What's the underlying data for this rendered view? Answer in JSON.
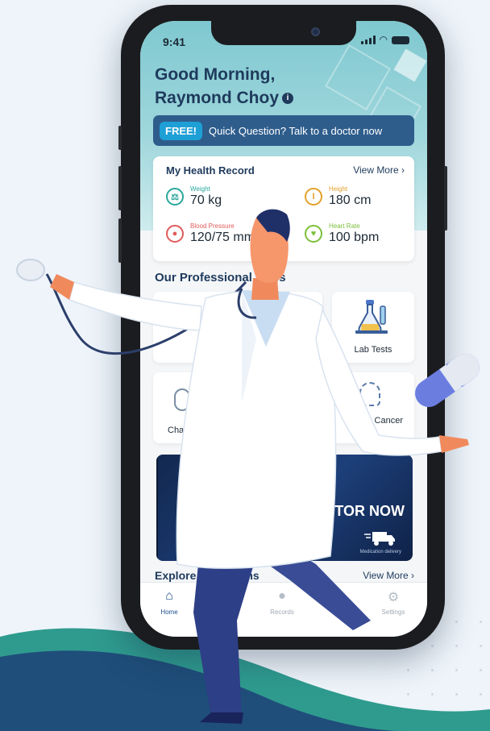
{
  "status": {
    "time": "9:41"
  },
  "greeting": {
    "line1": "Good Morning,",
    "line2": "Raymond Choy"
  },
  "promo": {
    "badge": "FREE!",
    "text": "Quick Question? Talk to a doctor now"
  },
  "health_record": {
    "title": "My Health Record",
    "view_more": "View More",
    "metrics": [
      {
        "label": "Weight",
        "value": "70 kg",
        "color": "#2aa79b",
        "icon": "scale-icon"
      },
      {
        "label": "Height",
        "value": "180 cm",
        "color": "#e2a12a",
        "icon": "ruler-icon"
      },
      {
        "label": "Blood Pressure",
        "value": "120/75 mm",
        "color": "#e05a5a",
        "icon": "blood-drop-icon"
      },
      {
        "label": "Heart Rate",
        "value": "100 bpm",
        "color": "#7bbf3a",
        "icon": "heart-icon"
      }
    ]
  },
  "services": {
    "title": "Our Professional  vices",
    "items": [
      {
        "label": "",
        "icon": "service-icon"
      },
      {
        "label": "Lab Tests",
        "icon": "flask-icon"
      },
      {
        "label": "Cha",
        "icon": "chat-icon"
      },
      {
        "label": "Cancer",
        "icon": "head-icon"
      }
    ]
  },
  "banner": {
    "text": "TOR NOW",
    "small": "Medication delivery",
    "icon": "delivery-truck-icon"
  },
  "explore": {
    "title": "Explore",
    "title_tail": "ns",
    "view_more": "View More"
  },
  "tabs": [
    {
      "label": "Home",
      "icon": "home-icon",
      "active": true
    },
    {
      "label": "Records",
      "icon": "person-icon",
      "active": false
    },
    {
      "label": "s",
      "icon": "notification-icon",
      "active": false
    },
    {
      "label": "Settings",
      "icon": "gear-icon",
      "active": false
    }
  ],
  "colors": {
    "brand_dark": "#1e3a5c",
    "promo": "#2e5d8c",
    "promo_badge": "#1e9fd6",
    "header": "#8fd0d6"
  }
}
